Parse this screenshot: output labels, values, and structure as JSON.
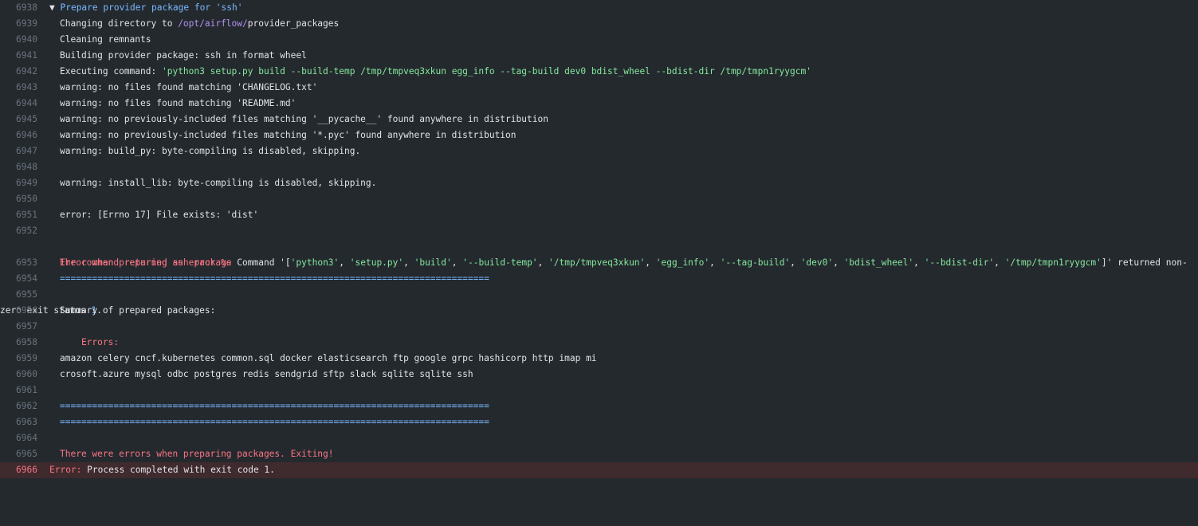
{
  "lines": [
    {
      "n": "6938",
      "group_prefix": "▼ ",
      "text": "Prepare provider package for 'ssh'"
    },
    {
      "n": "6939",
      "a": "Changing directory to ",
      "path_prefix": "/opt/airflow/",
      "path_rest": "provider_packages"
    },
    {
      "n": "6940",
      "text": "Cleaning remnants"
    },
    {
      "n": "6941",
      "text": "Building provider package: ssh in format wheel"
    },
    {
      "n": "6942",
      "a": "Executing command: ",
      "cmd": "'python3 setup.py build --build-temp /tmp/tmpveq3xkun egg_info --tag-build dev0 bdist_wheel --bdist-dir /tmp/tmpn1ryygcm'"
    },
    {
      "n": "6943",
      "text": "warning: no files found matching 'CHANGELOG.txt'"
    },
    {
      "n": "6944",
      "text": "warning: no files found matching 'README.md'"
    },
    {
      "n": "6945",
      "text": "warning: no previously-included files matching '__pycache__' found anywhere in distribution"
    },
    {
      "n": "6946",
      "text": "warning: no previously-included files matching '*.pyc' found anywhere in distribution"
    },
    {
      "n": "6947",
      "text": "warning: build_py: byte-compiling is disabled, skipping."
    },
    {
      "n": "6948",
      "text": ""
    },
    {
      "n": "6949",
      "text": "warning: install_lib: byte-compiling is disabled, skipping."
    },
    {
      "n": "6950",
      "text": ""
    },
    {
      "n": "6951",
      "text": "error: [Errno 17] File exists: 'dist'"
    },
    {
      "n": "6952",
      "err_a": "The command returned an error %s",
      "cmd_label": " Command ",
      "list_open": "'[",
      "items": [
        "'python3'",
        "'setup.py'",
        "'build'",
        "'--build-temp'",
        "'/tmp/tmpveq3xkun'",
        "'egg_info'",
        "'--tag-build'",
        "'dev0'",
        "'bdist_wheel'",
        "'--bdist-dir'",
        "'/tmp/tmpn1ryygcm'"
      ],
      "list_close": "]'",
      "tail": " returned non-",
      "wrap_text": "zero exit status ",
      "exit_num": "1",
      "exit_dot": "."
    },
    {
      "n": "6953",
      "text": "Error when preparing ssh package"
    },
    {
      "n": "6954",
      "text": "================================================================================"
    },
    {
      "n": "6955",
      "text": ""
    },
    {
      "n": "6956",
      "text": "Summary of prepared packages:"
    },
    {
      "n": "6957",
      "text": ""
    },
    {
      "n": "6958",
      "text": "    Errors:"
    },
    {
      "n": "6959",
      "text": "amazon celery cncf.kubernetes common.sql docker elasticsearch ftp google grpc hashicorp http imap mi"
    },
    {
      "n": "6960",
      "text": "crosoft.azure mysql odbc postgres redis sendgrid sftp slack sqlite sqlite ssh"
    },
    {
      "n": "6961",
      "text": ""
    },
    {
      "n": "6962",
      "text": "================================================================================"
    },
    {
      "n": "6963",
      "text": "================================================================================"
    },
    {
      "n": "6964",
      "text": ""
    },
    {
      "n": "6965",
      "text": "There were errors when preparing packages. Exiting!"
    },
    {
      "n": "6966",
      "err_prefix": "Error:",
      "text": " Process completed with exit code 1."
    }
  ],
  "colors": {
    "background": "#24292e",
    "text": "#e1e4e8",
    "line_number": "#6a737d",
    "string": "#85e89d",
    "path": "#b392f0",
    "error": "#f97583",
    "accent": "#79b8ff",
    "error_row_bg": "#3f2a2e"
  }
}
